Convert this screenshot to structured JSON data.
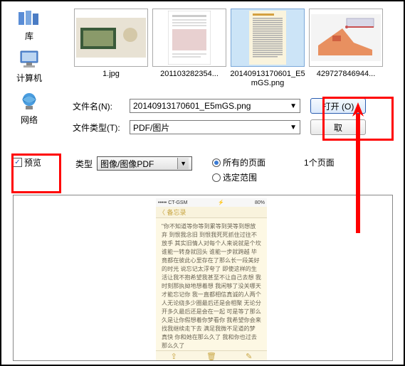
{
  "sidebar": {
    "items": [
      {
        "label": "库"
      },
      {
        "label": "计算机"
      },
      {
        "label": "网络"
      }
    ]
  },
  "thumbnails": [
    {
      "label": "1.jpg"
    },
    {
      "label": "201103282354..."
    },
    {
      "label": "20140913170601_E5mGS.png",
      "selected": true
    },
    {
      "label": "429727846944..."
    }
  ],
  "form": {
    "filename_label": "文件名(N):",
    "filename_value": "20140913170601_E5mGS.png",
    "filetype_label": "文件类型(T):",
    "filetype_value": "PDF/图片",
    "open_btn": "打开 (O)",
    "cancel_btn": "取"
  },
  "options": {
    "preview_checkbox": "预览",
    "type_label": "类型",
    "type_value": "图像/图像PDF",
    "radio_all": "所有的页面",
    "radio_range": "选定范围",
    "page_count": "1个页面",
    "preview_section": "预览"
  },
  "phone": {
    "carrier": "••••• CT-GSM",
    "wifi": "⚡",
    "battery": "80%",
    "back": "〈 备忘录",
    "body_text": "\"你不知道等你等到累等到哭等到想放弃 到恨我念旧 到恨我死死抓住过往不放手 其实旧情人对每个人来说就是个坎 谁能一转身就回头 谁能一步就跨越 毕竟都在彼此心里存在了那么长一段美好的时光 说忘记太浮夸了 即使这样的生活让我不抱希望我甚至不让自己去想 我时刻那执拗地想着想 我闲够了没关哪天才能忘记你 我一直都相信真诚的人两个人无论绕多少圈最后还是会相聚 无论分开多久最后还是会在一起 可是等了那么久是让你假想着你梦看你 我希望你会来找我继续走下去 满足我微不足道的梦 真快 你和她在那么久了 我和你也过去那么久了",
    "footer_icons": [
      "share",
      "delete",
      "compose"
    ]
  }
}
